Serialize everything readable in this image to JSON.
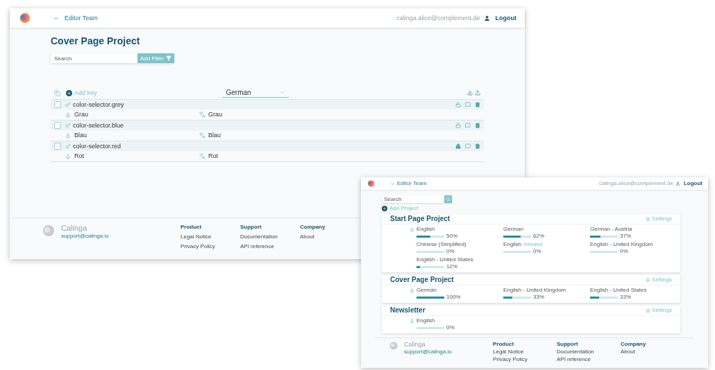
{
  "editor_window": {
    "team": "Editor Team",
    "user": "calinga.alice@complement.de",
    "logout": "Logout",
    "title": "Cover Page Project",
    "search": {
      "placeholder": "Search"
    },
    "filter_button": "Add Filter",
    "add_key": "Add key",
    "language": "German",
    "keys": [
      {
        "key": "color-selector.grey",
        "reference": "Grau",
        "translation": "Grau",
        "locked": false,
        "selected": false
      },
      {
        "key": "color-selector.blue",
        "reference": "Blau",
        "translation": "Blau",
        "locked": false,
        "selected": false
      },
      {
        "key": "color-selector.red",
        "reference": "Rot",
        "translation": "Rot",
        "locked": true,
        "selected": false
      }
    ],
    "footer": {
      "brand": "Calinga",
      "email": "support@calinga.io",
      "columns": [
        {
          "heading": "Product",
          "links": [
            "Legal Notice",
            "Privacy Policy"
          ]
        },
        {
          "heading": "Support",
          "links": [
            "Documentation",
            "API reference"
          ]
        },
        {
          "heading": "Company",
          "links": [
            "About"
          ]
        }
      ]
    }
  },
  "projects_window": {
    "team": "Editor Team",
    "user": "calinga.alice@complement.de",
    "logout": "Logout",
    "search": {
      "placeholder": "Search"
    },
    "add_project": "Add Project",
    "projects": [
      {
        "title": "Start Page Project",
        "settings": "Settings",
        "languages": [
          {
            "name": "English",
            "reference": true,
            "level": 0.5,
            "percent": "50%"
          },
          {
            "name": "German",
            "reference": false,
            "level": 0.62,
            "percent": "62%"
          },
          {
            "name": "German - Austria",
            "reference": false,
            "level": 0.37,
            "percent": "37%"
          },
          {
            "name": "Chinese (Simplified)",
            "reference": false,
            "level": 0,
            "percent": "0%"
          },
          {
            "name": "English",
            "tag": "Inbrand",
            "reference": false,
            "level": 0,
            "percent": "0%"
          },
          {
            "name": "English - United Kingdom",
            "reference": false,
            "level": 0,
            "percent": "0%"
          },
          {
            "name": "English - United States",
            "reference": false,
            "level": 0.12,
            "percent": "12%"
          }
        ]
      },
      {
        "title": "Cover Page Project",
        "settings": "Settings",
        "languages": [
          {
            "name": "German",
            "reference": true,
            "level": 1,
            "percent": "100%"
          },
          {
            "name": "English - United Kingdom",
            "reference": false,
            "level": 0.33,
            "percent": "33%"
          },
          {
            "name": "English - United States",
            "reference": false,
            "level": 0.33,
            "percent": "33%"
          }
        ]
      },
      {
        "title": "Newsletter",
        "settings": "Settings",
        "languages": [
          {
            "name": "English",
            "reference": true,
            "level": 0,
            "percent": "0%"
          }
        ]
      }
    ],
    "footer": {
      "brand": "Calinga",
      "email": "support@calinga.io",
      "columns": [
        {
          "heading": "Product",
          "links": [
            "Legal Notice",
            "Privacy Policy"
          ]
        },
        {
          "heading": "Support",
          "links": [
            "Documentation",
            "API reference"
          ]
        },
        {
          "heading": "Company",
          "links": [
            "About"
          ]
        }
      ]
    }
  }
}
